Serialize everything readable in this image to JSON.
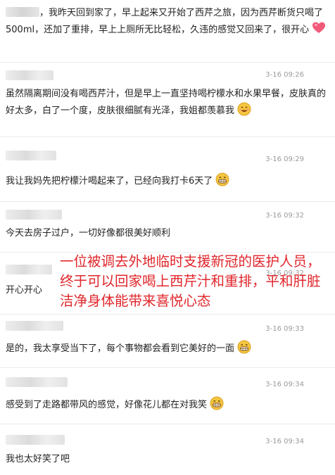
{
  "comments": [
    {
      "text": "，我昨天回到家了，早上起来又开始了西芹之旅，因为西芹断货只喝了500ml，还加了重排，早上上厕所无比轻松，久违的感觉又回来了，很开心",
      "time": ""
    },
    {
      "text": "虽然隔离期间没有喝西芹汁，但是早上一直坚持喝柠檬水和水果早餐，皮肤真的好太多，白了一个度，皮肤很细腻有光泽，我姐都羡慕我",
      "time": "3-16 09:26"
    },
    {
      "text": "我让我妈先把柠檬汁喝起来了，已经向我打卡6天了",
      "time": "3-16 09:29"
    },
    {
      "text": "今天去房子过户，一切好像都很美好顺利",
      "time": "3-16 09:32"
    },
    {
      "text": "开心开心",
      "time": "3-16 09:32"
    },
    {
      "text": "是的，我太享受当下了，每个事物都会看到它美好的一面",
      "time": "3-16 09:33"
    },
    {
      "text": "感受到了走路都带风的感觉，好像花儿都在对我笑",
      "time": "3-16 09:34"
    },
    {
      "text": "我也太好笑了吧",
      "time": "3-16 09:34"
    }
  ],
  "overlay_text": "一位被调去外地临时支援新冠的医护人员，终于可以回家喝上西芹汁和重排，平和肝脏洁净身体能带来喜悦心态",
  "icons": {
    "heart": "heart-icon",
    "smile": "smile-icon",
    "grin": "grin-icon"
  },
  "colors": {
    "overlay": "#e0262b",
    "timestamp": "#9a9a9a",
    "emoji": "#f5c542"
  }
}
